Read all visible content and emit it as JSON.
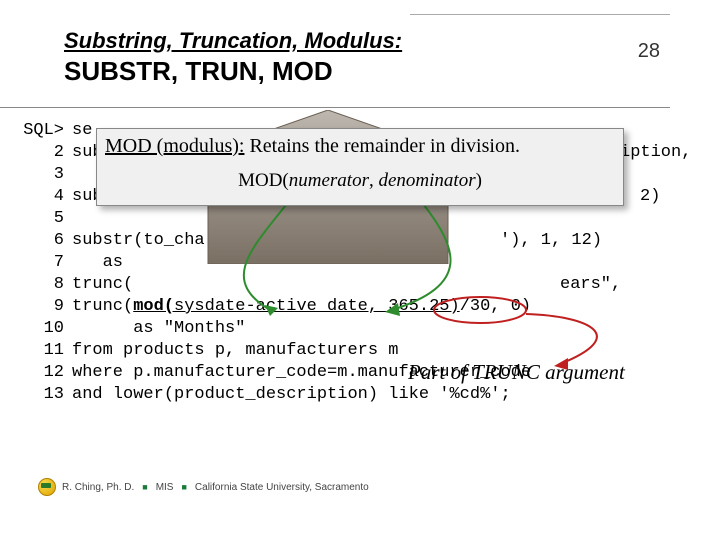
{
  "header": {
    "title_line1": "Substring, Truncation, Modulus:",
    "title_line2": "SUBSTR, TRUN, MOD",
    "page_number": "28"
  },
  "overlay": {
    "line1_prefix": "MOD (modulus):",
    "line1_rest": " Retains the remainder in division.",
    "func_name": "MOD(",
    "arg1": "numerator",
    "sep": ", ",
    "arg2": "denominator",
    "close": ")"
  },
  "code": {
    "prompt": "SQL>",
    "lines": [
      {
        "n": "SQL>",
        "pre": "se",
        "rest": ""
      },
      {
        "n": "2",
        "pre": "sub",
        "rest": ""
      },
      {
        "n": "3",
        "pre": "",
        "rest": ""
      },
      {
        "n": "4",
        "pre": "sub",
        "rest": ""
      },
      {
        "n": "5",
        "pre": "",
        "rest": ""
      },
      {
        "n": "6",
        "pre": "substr(to_cha",
        "rest": "'), 1, 12)"
      },
      {
        "n": "7",
        "pre": "   as",
        "rest": ""
      },
      {
        "n": "8",
        "pre": "trunc(",
        "rest": "ears\","
      },
      {
        "n": "9",
        "pre": "trunc(",
        "mod_open": "mod(",
        "mid": "sysdate-active_date, 365.25)",
        "tail": "/30, 0)"
      },
      {
        "n": "10",
        "pre": "      as \"Months\"",
        "rest": ""
      },
      {
        "n": "11",
        "pre": "from products p, manufacturers m",
        "rest": ""
      },
      {
        "n": "12",
        "pre": "where p.manufacturer_code=m.manufacturer_code",
        "rest": ""
      },
      {
        "n": "13",
        "pre": "and lower(product_description) like '%cd%';",
        "rest": ""
      }
    ],
    "frag_right1": "iption,",
    "frag_right2": "2)"
  },
  "annotation": "Part of TRUNC argument",
  "footer": {
    "author": "R. Ching, Ph. D.",
    "dept": "MIS",
    "org": "California State University, Sacramento"
  }
}
